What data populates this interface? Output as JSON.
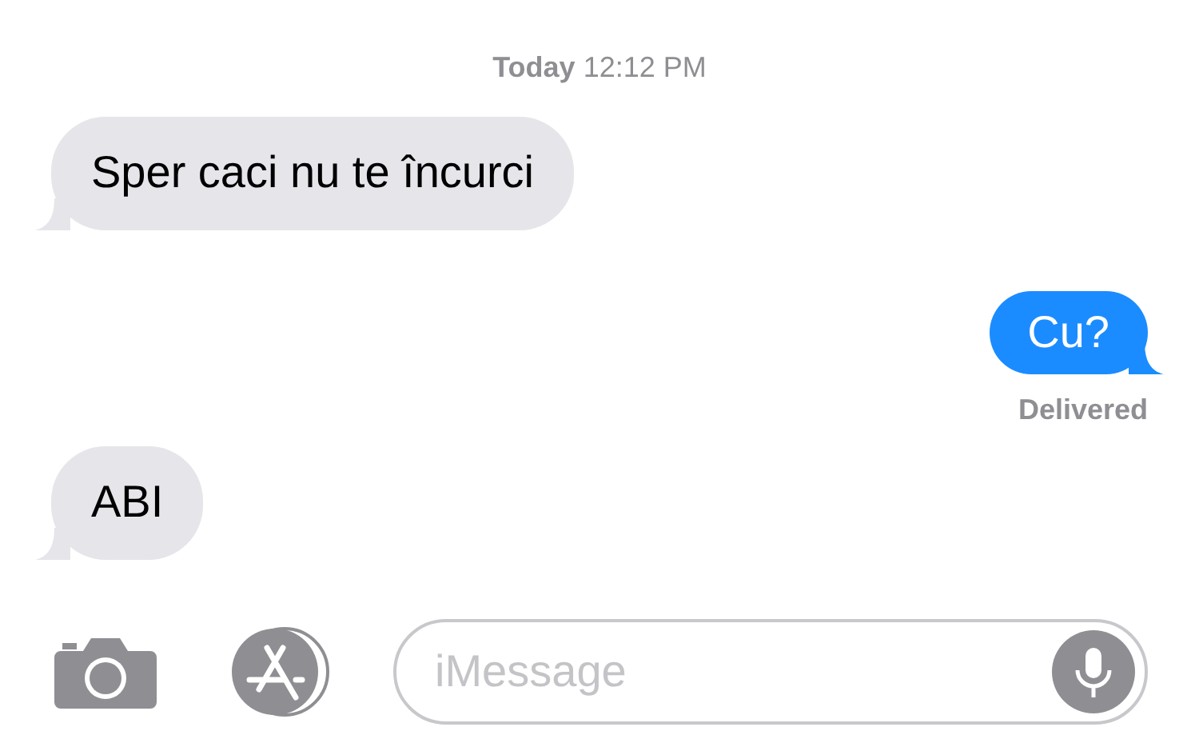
{
  "timestamp": {
    "day": "Today",
    "time": "12:12 PM"
  },
  "messages": [
    {
      "kind": "received",
      "text": "Sper caci nu te încurci"
    },
    {
      "kind": "sent",
      "text": "Cu?",
      "status": "Delivered"
    },
    {
      "kind": "received",
      "text": "ABI"
    }
  ],
  "composer": {
    "placeholder": "iMessage"
  }
}
